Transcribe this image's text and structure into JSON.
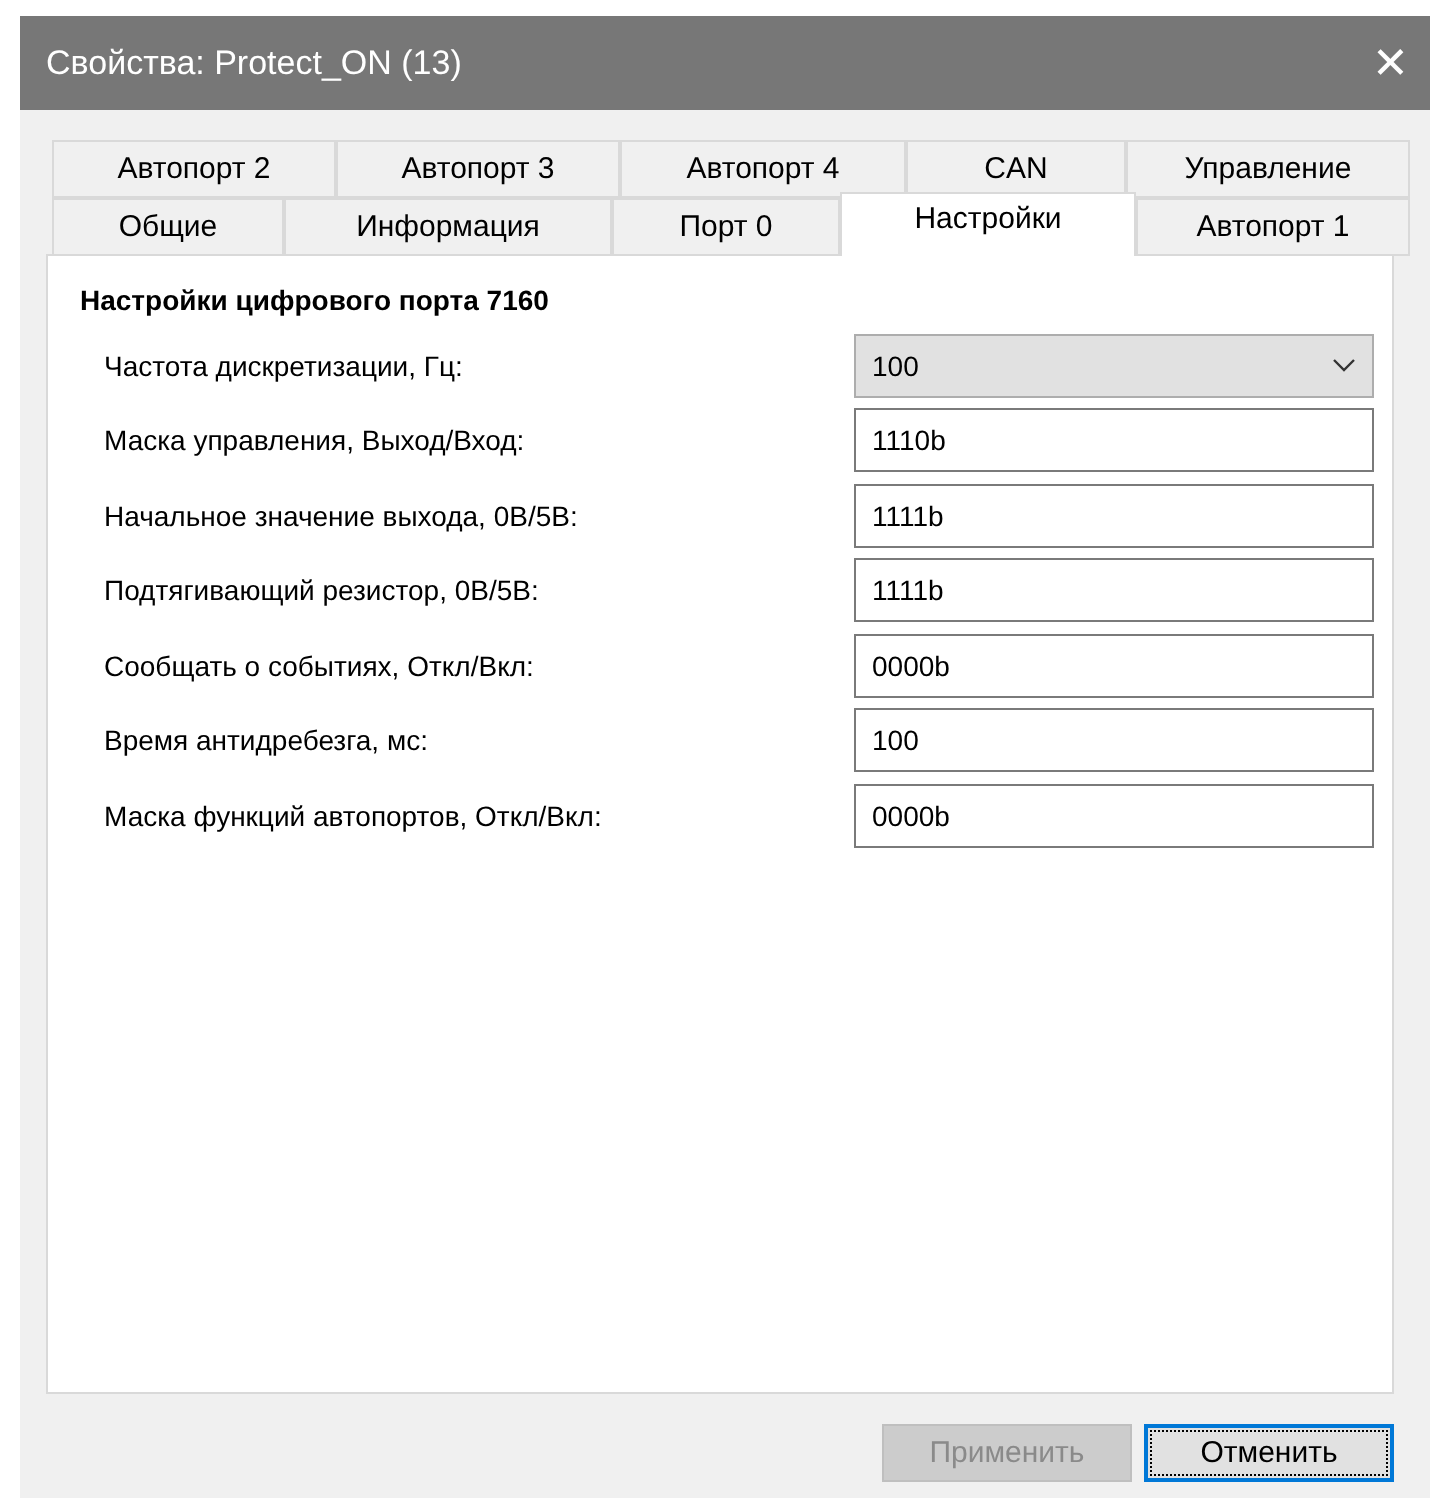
{
  "window": {
    "title": "Свойства: Protect_ON (13)",
    "close": "✕"
  },
  "tab_rows": [
    {
      "tabs": [
        {
          "label": "Автопорт 2",
          "selected": false
        },
        {
          "label": "Автопорт 3",
          "selected": false
        },
        {
          "label": "Автопорт 4",
          "selected": false
        },
        {
          "label": "CAN",
          "selected": false
        },
        {
          "label": "Управление",
          "selected": false
        }
      ]
    },
    {
      "tabs": [
        {
          "label": "Общие",
          "selected": false
        },
        {
          "label": "Информация",
          "selected": false
        },
        {
          "label": "Порт 0",
          "selected": false
        },
        {
          "label": "Настройки",
          "selected": true
        },
        {
          "label": "Автопорт 1",
          "selected": false
        }
      ]
    }
  ],
  "section": {
    "title": "Настройки цифрового порта 7160"
  },
  "fields": [
    {
      "kind": "dropdown",
      "label": "Частота дискретизации, Гц:",
      "value": "100"
    },
    {
      "kind": "text",
      "label": "Маска управления, Выход/Вход:",
      "value": "1110b"
    },
    {
      "kind": "text",
      "label": "Начальное значение выхода, 0В/5В:",
      "value": "1111b"
    },
    {
      "kind": "text",
      "label": "Подтягивающий резистор, 0В/5В:",
      "value": "1111b"
    },
    {
      "kind": "text",
      "label": "Сообщать о событиях, Откл/Вкл:",
      "value": "0000b"
    },
    {
      "kind": "text",
      "label": "Время антидребезга, мс:",
      "value": "100"
    },
    {
      "kind": "text",
      "label": "Маска функций автопортов, Откл/Вкл:",
      "value": "0000b"
    }
  ],
  "buttons": [
    {
      "label": "Применить",
      "disabled": true,
      "focused": false
    },
    {
      "label": "Отменить",
      "disabled": false,
      "focused": true
    }
  ]
}
